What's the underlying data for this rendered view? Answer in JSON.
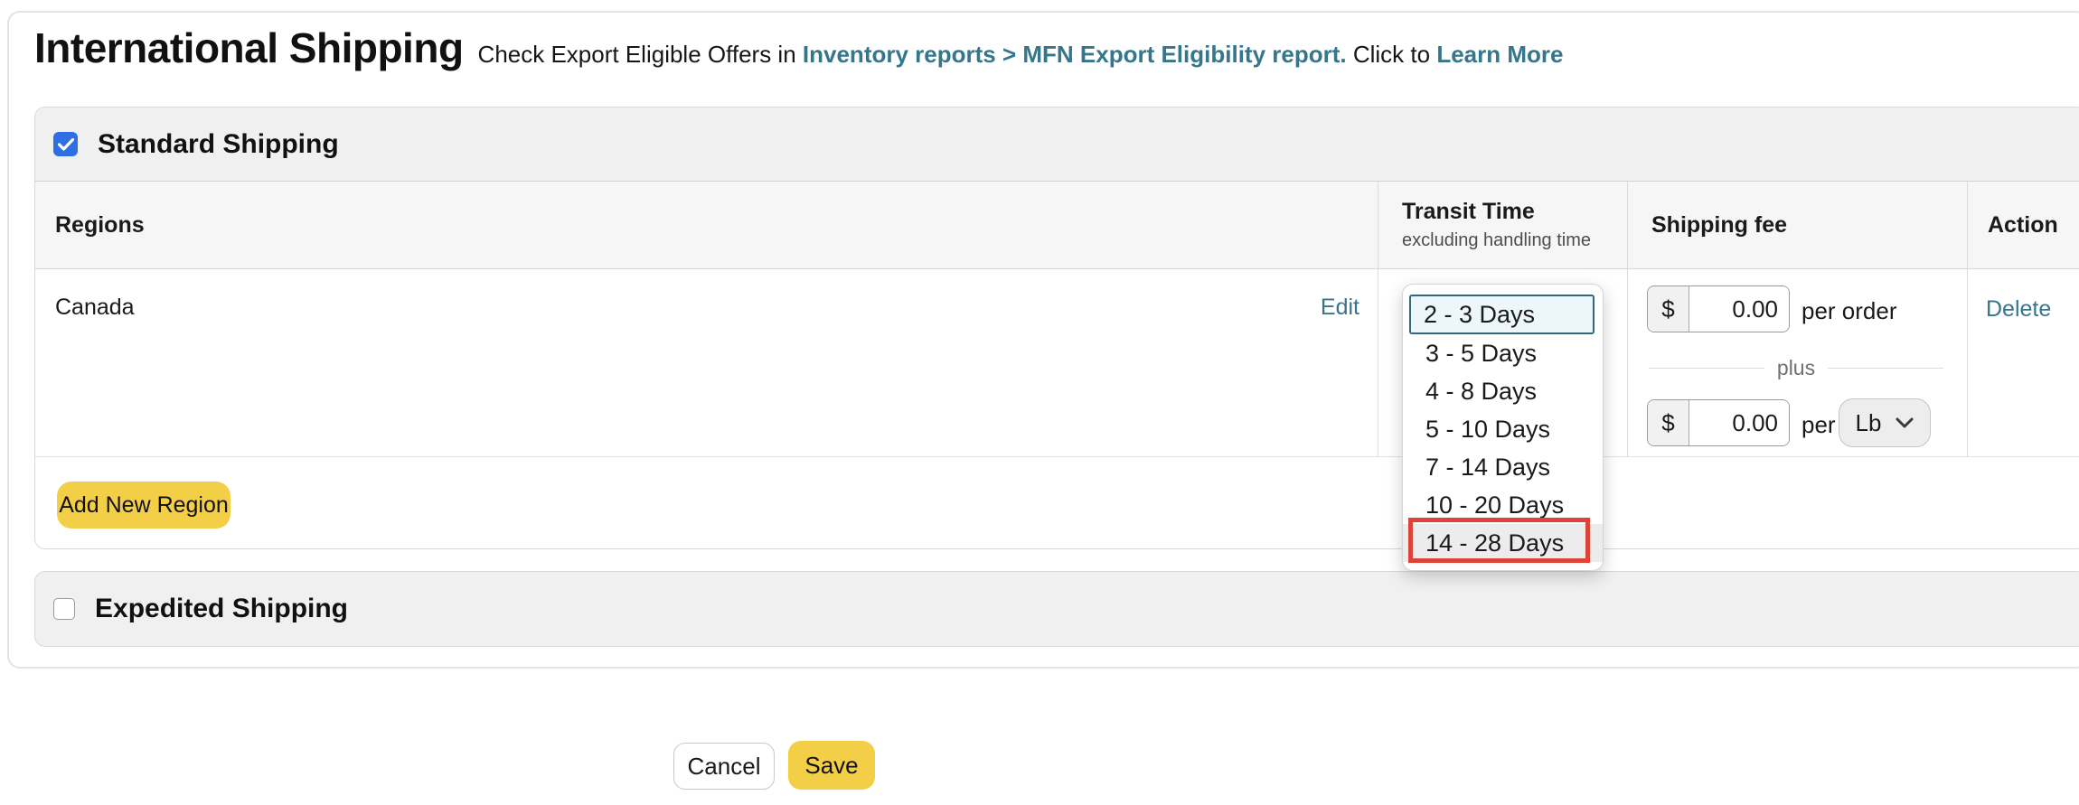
{
  "page": {
    "title": "International Shipping",
    "subtitle_prefix": "Check Export Eligible Offers in",
    "subtitle_link1": "Inventory reports > MFN Export Eligibility report.",
    "subtitle_mid": "Click to",
    "subtitle_link2": "Learn More"
  },
  "standard": {
    "label": "Standard Shipping",
    "checked": true,
    "table": {
      "headers": {
        "regions": "Regions",
        "transit_title": "Transit Time",
        "transit_sub": "excluding handling time",
        "fee": "Shipping fee",
        "action": "Action"
      }
    },
    "row": {
      "region": "Canada",
      "edit": "Edit",
      "delete": "Delete",
      "fee_per_order": {
        "currency": "$",
        "value": "0.00",
        "suffix": "per order"
      },
      "plus": "plus",
      "fee_per_weight": {
        "currency": "$",
        "value": "0.00",
        "suffix": "per",
        "unit": "Lb"
      }
    },
    "add_button": "Add New Region"
  },
  "dropdown": {
    "selected": "2 - 3 Days",
    "options": [
      "3 - 5 Days",
      "4 - 8 Days",
      "5 - 10 Days",
      "7 - 14 Days",
      "10 - 20 Days",
      "14 - 28 Days"
    ],
    "highlighted_option": "14 - 28 Days"
  },
  "expedited": {
    "label": "Expedited Shipping",
    "checked": false
  },
  "footer": {
    "cancel": "Cancel",
    "save": "Save"
  },
  "colors": {
    "link_teal": "#35768c",
    "accent_yellow": "#f2cf46",
    "checkbox_blue": "#2f6fe4",
    "annotation_red": "#dc4437",
    "select_highlight_bg": "#edf7fb",
    "select_highlight_border": "#33677a",
    "section_header_bg": "#f0f0f1"
  }
}
